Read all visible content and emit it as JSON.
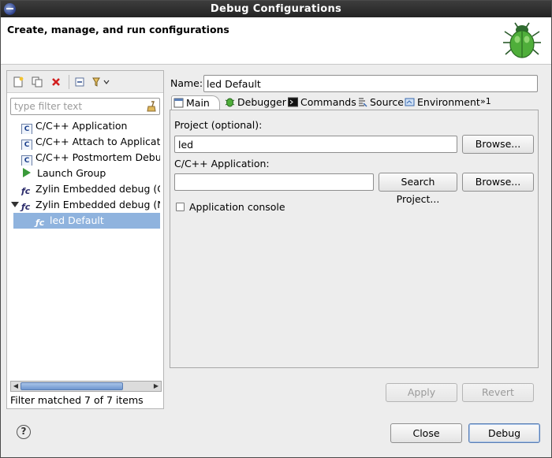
{
  "window": {
    "title": "Debug Configurations"
  },
  "banner": {
    "heading": "Create, manage, and run configurations"
  },
  "left": {
    "filter_placeholder": "type filter text",
    "tree": [
      {
        "label": "C/C++ Application",
        "icon": "c-application-icon"
      },
      {
        "label": "C/C++ Attach to Application",
        "icon": "c-attach-icon"
      },
      {
        "label": "C/C++ Postmortem Debugger",
        "icon": "c-postmortem-icon"
      },
      {
        "label": "Launch Group",
        "icon": "launch-group-icon"
      },
      {
        "label": "Zylin Embedded debug (Cygwin)",
        "icon": "zylin-icon"
      },
      {
        "label": "Zylin Embedded debug (Native)",
        "icon": "zylin-icon",
        "expanded": true
      },
      {
        "label": "led Default",
        "icon": "zylin-config-icon",
        "selected": true
      }
    ],
    "filter_status": "Filter matched 7 of 7 items"
  },
  "right": {
    "name_label": "Name:",
    "name_value": "led Default",
    "tabs": [
      {
        "label": "Main",
        "active": true
      },
      {
        "label": "Debugger"
      },
      {
        "label": "Commands"
      },
      {
        "label": "Source"
      },
      {
        "label": "Environment"
      }
    ],
    "tab_overflow": "»1",
    "project_label": "Project (optional):",
    "project_value": "led",
    "browse_label": "Browse...",
    "app_label": "C/C++ Application:",
    "app_value": "",
    "search_project_label": "Search Project...",
    "app_browse_label": "Browse...",
    "console_label": "Application console",
    "apply_label": "Apply",
    "revert_label": "Revert"
  },
  "footer": {
    "close_label": "Close",
    "debug_label": "Debug"
  },
  "colors": {
    "selection": "#8fb3de",
    "titlebar": "#2b2b2b"
  }
}
